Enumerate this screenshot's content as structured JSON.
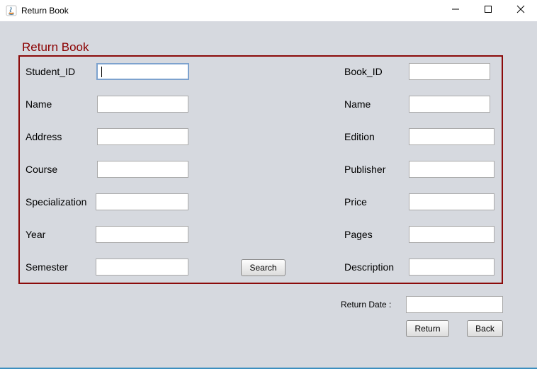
{
  "window": {
    "title": "Return Book"
  },
  "panel": {
    "title": "Return Book"
  },
  "student": {
    "student_id_label": "Student_ID",
    "name_label": "Name",
    "address_label": "Address",
    "course_label": "Course",
    "specialization_label": "Specialization",
    "year_label": "Year",
    "semester_label": "Semester"
  },
  "book": {
    "book_id_label": "Book_ID",
    "name_label": "Name",
    "edition_label": "Edition",
    "publisher_label": "Publisher",
    "price_label": "Price",
    "pages_label": "Pages",
    "description_label": "Description"
  },
  "actions": {
    "search_label": "Search",
    "return_date_label": "Return Date :",
    "return_label": "Return",
    "back_label": "Back"
  }
}
